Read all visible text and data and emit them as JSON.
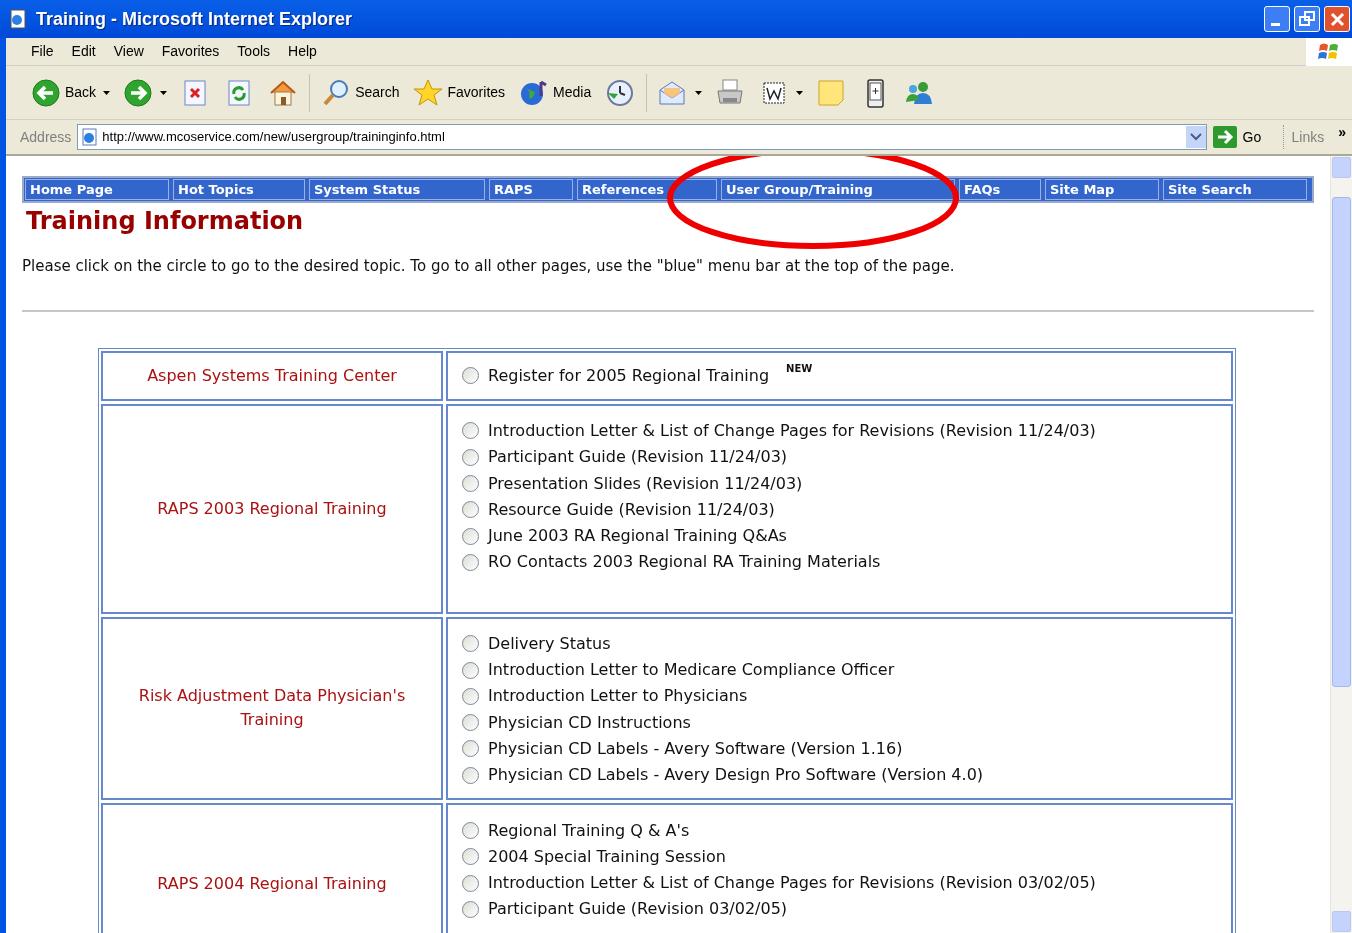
{
  "window": {
    "title": "Training - Microsoft Internet Explorer"
  },
  "menu": [
    "File",
    "Edit",
    "View",
    "Favorites",
    "Tools",
    "Help"
  ],
  "toolbar": [
    {
      "kind": "back",
      "label": "Back"
    },
    {
      "kind": "forward"
    },
    {
      "kind": "stop"
    },
    {
      "kind": "refresh"
    },
    {
      "kind": "home"
    },
    {
      "kind": "search",
      "label": "Search"
    },
    {
      "kind": "favorites",
      "label": "Favorites"
    },
    {
      "kind": "media",
      "label": "Media"
    },
    {
      "kind": "history"
    },
    {
      "kind": "mail"
    },
    {
      "kind": "print"
    },
    {
      "kind": "edit"
    },
    {
      "kind": "note"
    },
    {
      "kind": "device"
    },
    {
      "kind": "messenger"
    }
  ],
  "address": {
    "label": "Address",
    "value": "http://www.mcoservice.com/new/usergroup/traininginfo.html",
    "go": "Go",
    "links": "Links",
    "more": "»"
  },
  "nav": [
    "Home Page",
    "Hot Topics",
    "System Status",
    "RAPS",
    "References",
    "User Group/Training",
    "FAQs",
    "Site Map",
    "Site Search"
  ],
  "heading": "Training Information",
  "intro": "Please click on the circle to go to the desired topic. To go to all other pages, use the \"blue\" menu bar at the top of the page.",
  "sections": [
    {
      "title": "Aspen Systems Training Center",
      "items": [
        {
          "label": "Register for 2005 Regional Training",
          "badge": "NEW",
          "selected": false
        }
      ]
    },
    {
      "title": "RAPS 2003 Regional Training",
      "items": [
        {
          "label": "Introduction Letter & List of Change Pages for Revisions (Revision 11/24/03)",
          "selected": false
        },
        {
          "label": "Participant Guide (Revision 11/24/03)",
          "selected": false
        },
        {
          "label": "Presentation Slides (Revision 11/24/03)",
          "selected": false
        },
        {
          "label": "Resource Guide (Revision 11/24/03)",
          "selected": false
        },
        {
          "label": "June 2003 RA Regional Training Q&As",
          "selected": false
        },
        {
          "label": "RO Contacts 2003 Regional RA Training Materials",
          "selected": false
        }
      ]
    },
    {
      "title": "Risk Adjustment Data Physician's Training",
      "items": [
        {
          "label": "Delivery Status",
          "selected": false
        },
        {
          "label": "Introduction Letter to Medicare Compliance Officer",
          "selected": false
        },
        {
          "label": "Introduction Letter to Physicians",
          "selected": false
        },
        {
          "label": "Physician CD Instructions",
          "selected": false
        },
        {
          "label": "Physician CD Labels - Avery Software (Version 1.16)",
          "selected": false
        },
        {
          "label": "Physician CD Labels - Avery Design Pro Software (Version 4.0)",
          "selected": false
        }
      ]
    },
    {
      "title": "RAPS 2004 Regional Training",
      "items": [
        {
          "label": "Regional Training Q & A's",
          "selected": false
        },
        {
          "label": "2004 Special Training Session",
          "selected": false
        },
        {
          "label": "Introduction Letter & List of Change Pages for Revisions (Revision 03/02/05)",
          "selected": false
        },
        {
          "label": "Participant Guide (Revision 03/02/05)",
          "selected": false
        }
      ]
    }
  ]
}
